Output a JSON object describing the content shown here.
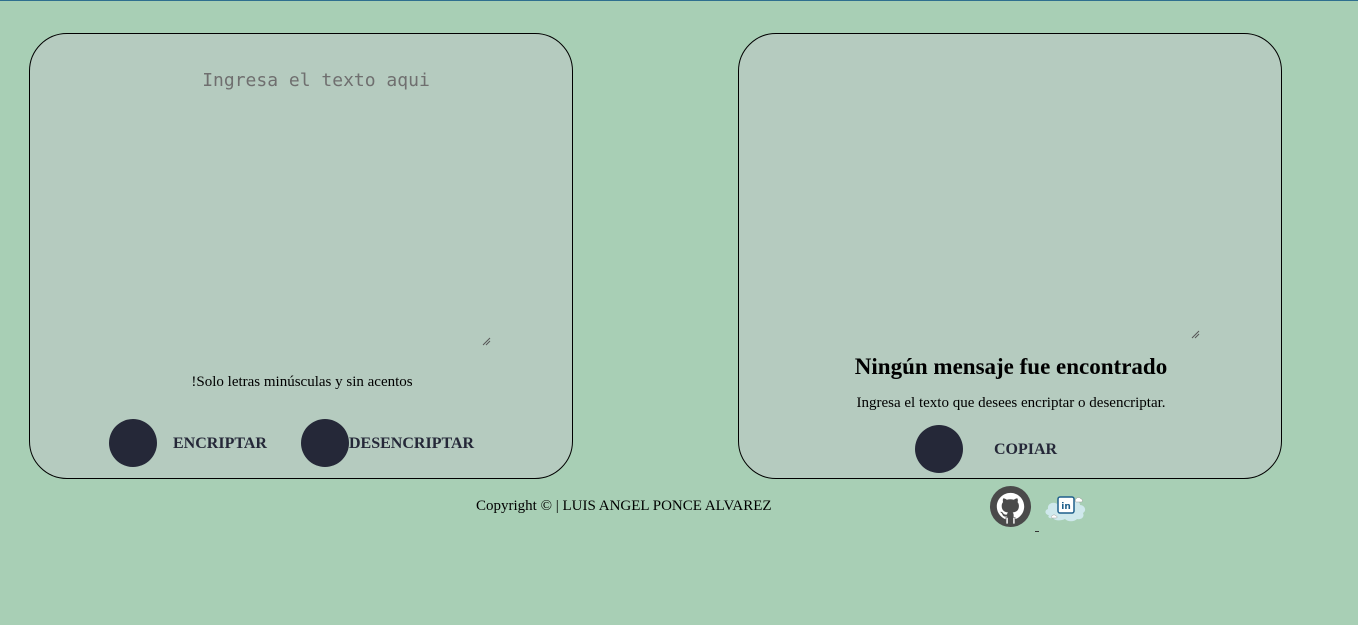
{
  "encrypt_panel": {
    "input_placeholder": "Ingresa el texto aqui",
    "input_value": "",
    "hint": "!Solo letras minúsculas y sin acentos",
    "encrypt_label": "ENCRIPTAR",
    "decrypt_label": "DESENCRIPTAR"
  },
  "output_panel": {
    "output_value": "",
    "empty_title": "Ningún mensaje fue encontrado",
    "empty_subtitle": "Ingresa el texto que desees encriptar o desencriptar.",
    "copy_label": "COPIAR"
  },
  "footer": {
    "copyright": "Copyright © | LUIS ANGEL PONCE ALVAREZ",
    "icons": [
      "github-icon",
      "linkedin-icon"
    ]
  },
  "colors": {
    "background": "#a8cfb5",
    "panel": "#b5cbbf",
    "button": "#252838",
    "accent_line": "#2f6f8f"
  }
}
